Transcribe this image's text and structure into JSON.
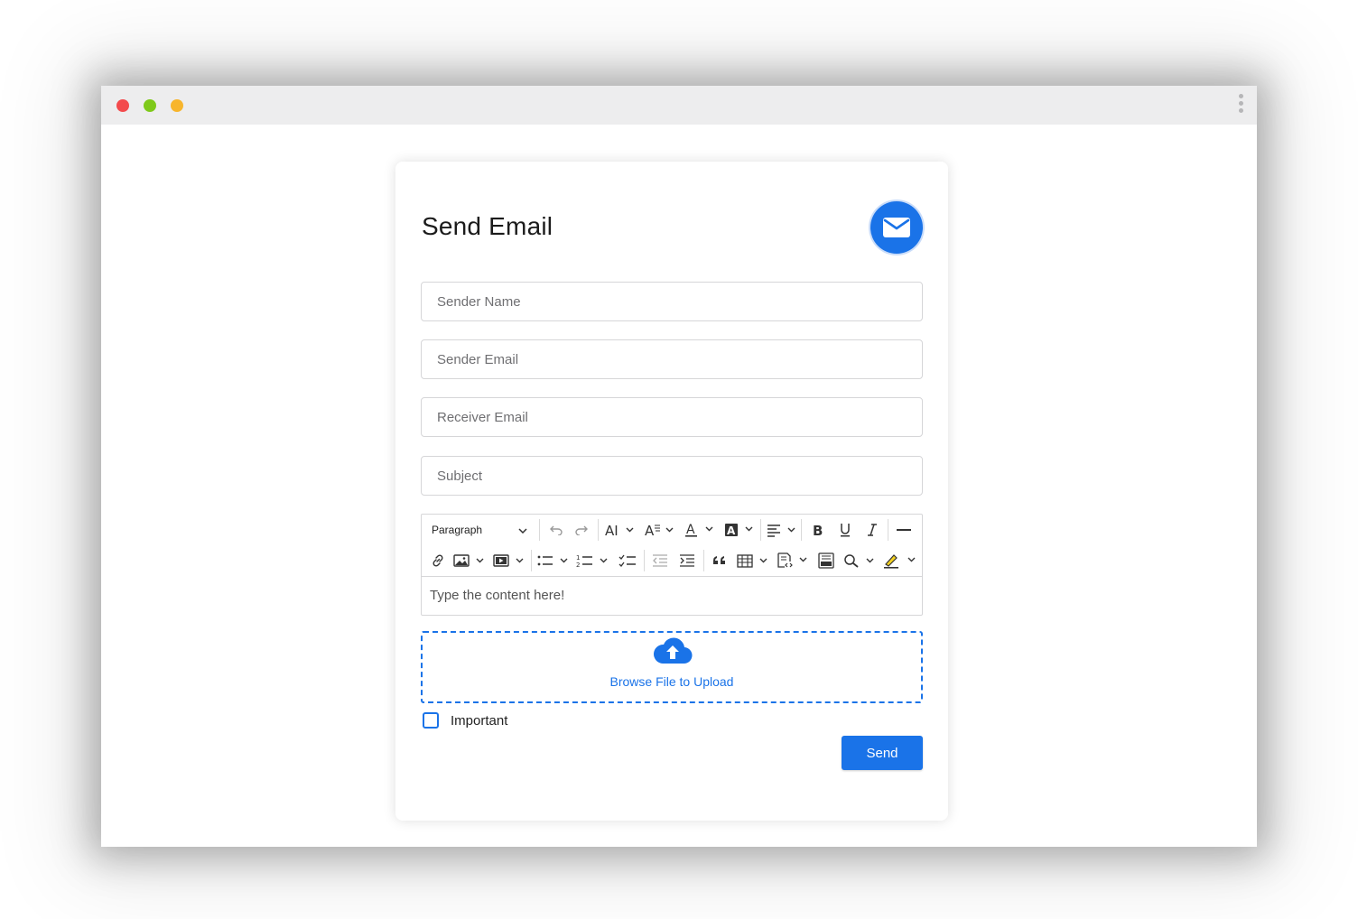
{
  "form": {
    "title": "Send Email",
    "fields": {
      "sender_name_placeholder": "Sender Name",
      "sender_email_placeholder": "Sender Email",
      "receiver_email_placeholder": "Receiver Email",
      "subject_placeholder": "Subject"
    },
    "editor": {
      "block_format": "Paragraph",
      "content_placeholder": "Type the content here!"
    },
    "upload": {
      "label": "Browse File to Upload"
    },
    "important_label": "Important",
    "important_checked": false,
    "send_label": "Send"
  },
  "colors": {
    "accent": "#1a73e8",
    "close_dot": "#f34a4c",
    "minimize_dot": "#7ec91a",
    "maximize_dot": "#f7b52c"
  },
  "icons": [
    "mail-icon",
    "undo-icon",
    "redo-icon",
    "font-size-icon",
    "font-family-icon",
    "font-color-icon",
    "font-background-icon",
    "align-icon",
    "bold-icon",
    "underline-icon",
    "italic-icon",
    "horizontal-line-icon",
    "link-icon",
    "image-icon",
    "media-icon",
    "bulleted-list-icon",
    "numbered-list-icon",
    "todo-list-icon",
    "outdent-icon",
    "indent-icon",
    "blockquote-icon",
    "table-icon",
    "source-icon",
    "html-embed-icon",
    "find-replace-icon",
    "highlight-icon",
    "cloud-upload-icon"
  ]
}
